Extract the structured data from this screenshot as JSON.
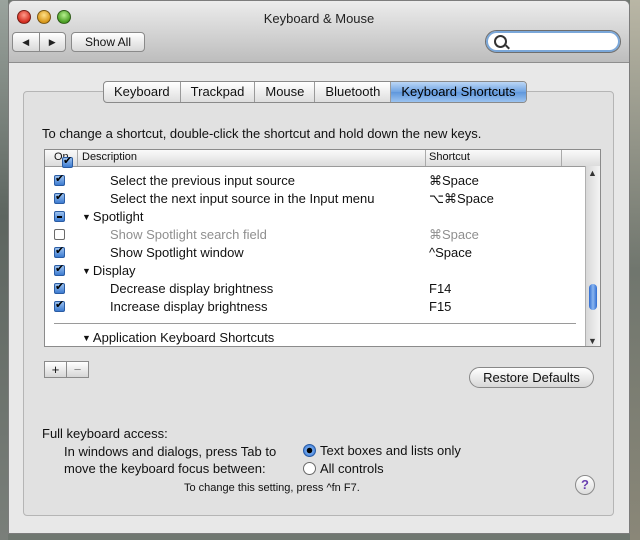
{
  "window": {
    "title": "Keyboard & Mouse"
  },
  "toolbar": {
    "back_glyph": "◀",
    "forward_glyph": "▶",
    "show_all_label": "Show All",
    "search_value": "",
    "search_icon": "search-icon"
  },
  "tabs": [
    {
      "label": "Keyboard",
      "active": false
    },
    {
      "label": "Trackpad",
      "active": false
    },
    {
      "label": "Mouse",
      "active": false
    },
    {
      "label": "Bluetooth",
      "active": false
    },
    {
      "label": "Keyboard Shortcuts",
      "active": true
    }
  ],
  "instruction": "To change a shortcut, double-click the shortcut and hold down the new keys.",
  "table": {
    "columns": {
      "on": "On",
      "description": "Description",
      "shortcut": "Shortcut"
    },
    "rows": [
      {
        "state": "checked",
        "description": "Select the previous input source",
        "shortcut": "⌘Space",
        "level": 2,
        "enabled": true
      },
      {
        "state": "checked",
        "description": "Select the next input source in the Input menu",
        "shortcut": "⌥⌘Space",
        "level": 2,
        "enabled": true
      },
      {
        "state": "mixed",
        "description": "Spotlight",
        "shortcut": "",
        "level": 1,
        "group": true,
        "enabled": true
      },
      {
        "state": "unchecked",
        "description": "Show Spotlight search field",
        "shortcut": "⌘Space",
        "level": 2,
        "enabled": false
      },
      {
        "state": "checked",
        "description": "Show Spotlight window",
        "shortcut": "^Space",
        "level": 2,
        "enabled": true
      },
      {
        "state": "checked",
        "description": "Display",
        "shortcut": "",
        "level": 1,
        "group": true,
        "enabled": true
      },
      {
        "state": "checked",
        "description": "Decrease display brightness",
        "shortcut": "F14",
        "level": 2,
        "enabled": true
      },
      {
        "state": "checked",
        "description": "Increase display brightness",
        "shortcut": "F15",
        "level": 2,
        "enabled": true
      }
    ],
    "app_shortcuts_label": "Application Keyboard Shortcuts"
  },
  "buttons": {
    "add": "+",
    "remove": "−",
    "restore_defaults": "Restore Defaults",
    "help": "?"
  },
  "full_keyboard_access": {
    "label": "Full keyboard access:",
    "description_line1": "In windows and dialogs, press Tab to",
    "description_line2": "move the keyboard focus between:",
    "options": [
      {
        "label": "Text boxes and lists only",
        "selected": true
      },
      {
        "label": "All controls",
        "selected": false
      }
    ],
    "hint": "To change this setting, press ^fn F7."
  }
}
